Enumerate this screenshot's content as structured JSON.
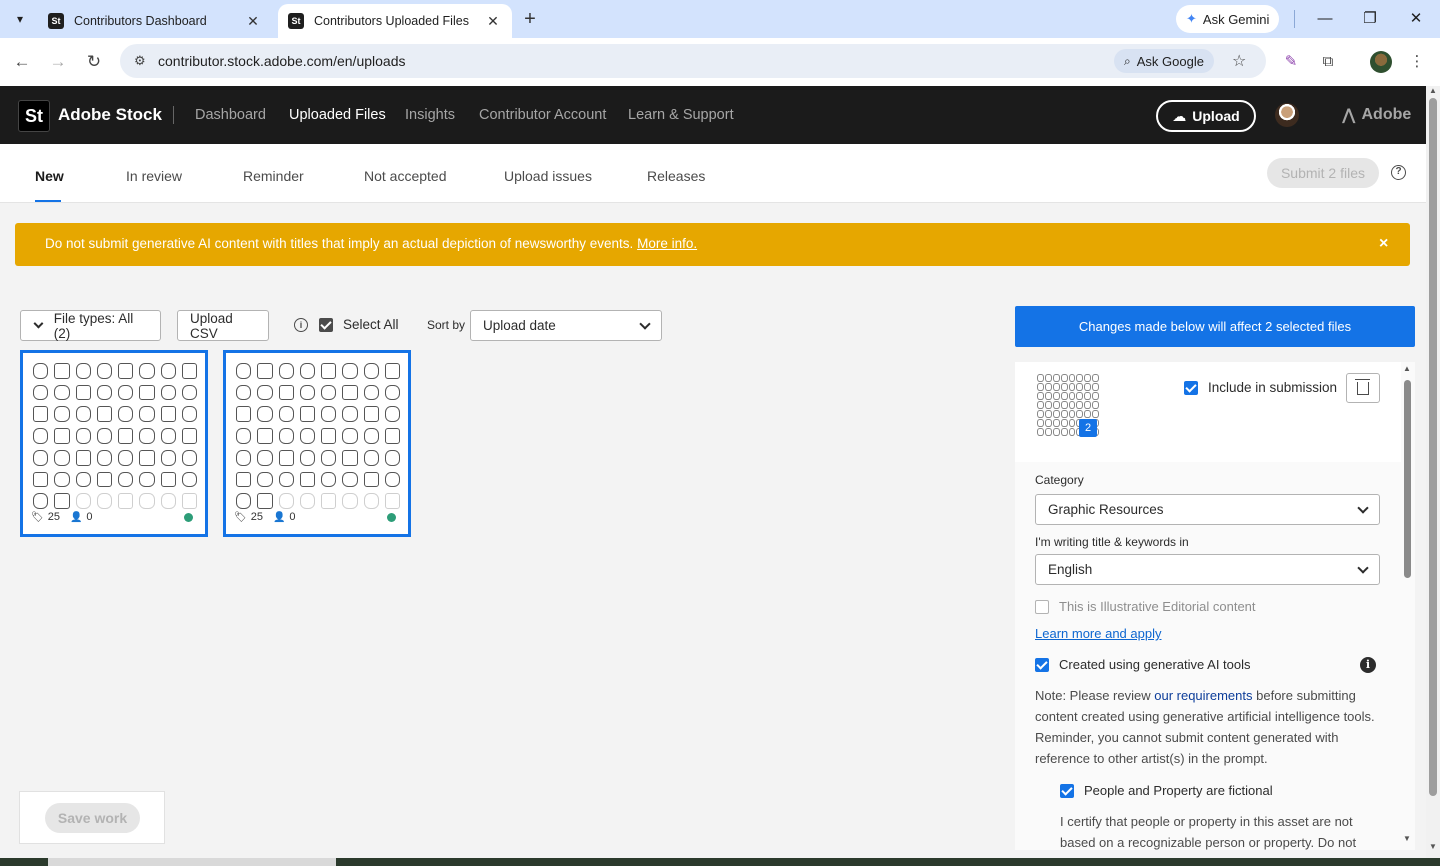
{
  "browser": {
    "tabs": [
      {
        "title": "Contributors Dashboard",
        "favicon": "St"
      },
      {
        "title": "Contributors Uploaded Files",
        "favicon": "St"
      }
    ],
    "ask_gemini": "Ask Gemini",
    "url": "contributor.stock.adobe.com/en/uploads",
    "ask_google": "Ask Google"
  },
  "header": {
    "logo": "St",
    "brand": "Adobe Stock",
    "nav": [
      "Dashboard",
      "Uploaded Files",
      "Insights",
      "Contributor Account",
      "Learn & Support"
    ],
    "upload_label": "Upload",
    "adobe_label": "Adobe"
  },
  "subnav": {
    "tabs": [
      "New",
      "In review",
      "Reminder",
      "Not accepted",
      "Upload issues",
      "Releases"
    ],
    "submit_label": "Submit 2 files",
    "help": "?"
  },
  "banner": {
    "message": "Do not submit generative AI content with titles that imply an actual depiction of newsworthy events.",
    "link": "More info.",
    "close": "×"
  },
  "filters": {
    "file_types": "File types: All (2)",
    "upload_csv": "Upload CSV",
    "info": "i",
    "select_all": "Select All",
    "sort_by": "Sort by",
    "sort_value": "Upload date"
  },
  "thumbnails": [
    {
      "tags": "25",
      "people": "0"
    },
    {
      "tags": "25",
      "people": "0"
    }
  ],
  "save_work": "Save work",
  "panel": {
    "changes_message": "Changes made below will affect 2 selected files",
    "count_badge": "2",
    "include_label": "Include in submission",
    "category_label": "Category",
    "category_value": "Graphic Resources",
    "language_label": "I'm writing title & keywords in",
    "language_value": "English",
    "editorial_label": "This is Illustrative Editorial content",
    "learn_more": "Learn more and apply",
    "gen_ai_label": "Created using generative AI tools",
    "info_icon": "i",
    "note_prefix": "Note: Please review ",
    "note_link": "our requirements",
    "note_suffix": " before submitting content created using generative artificial intelligence tools. Reminder, you cannot submit content generated with reference to other artist(s) in the prompt.",
    "fictional_label": "People and Property are fictional",
    "certify_text": "I certify that people or property in this asset are not based on a recognizable person or property. Do not"
  },
  "colors": {
    "accent": "#1473e6",
    "banner": "#e6a700",
    "header_bg": "#1b1b1b"
  }
}
